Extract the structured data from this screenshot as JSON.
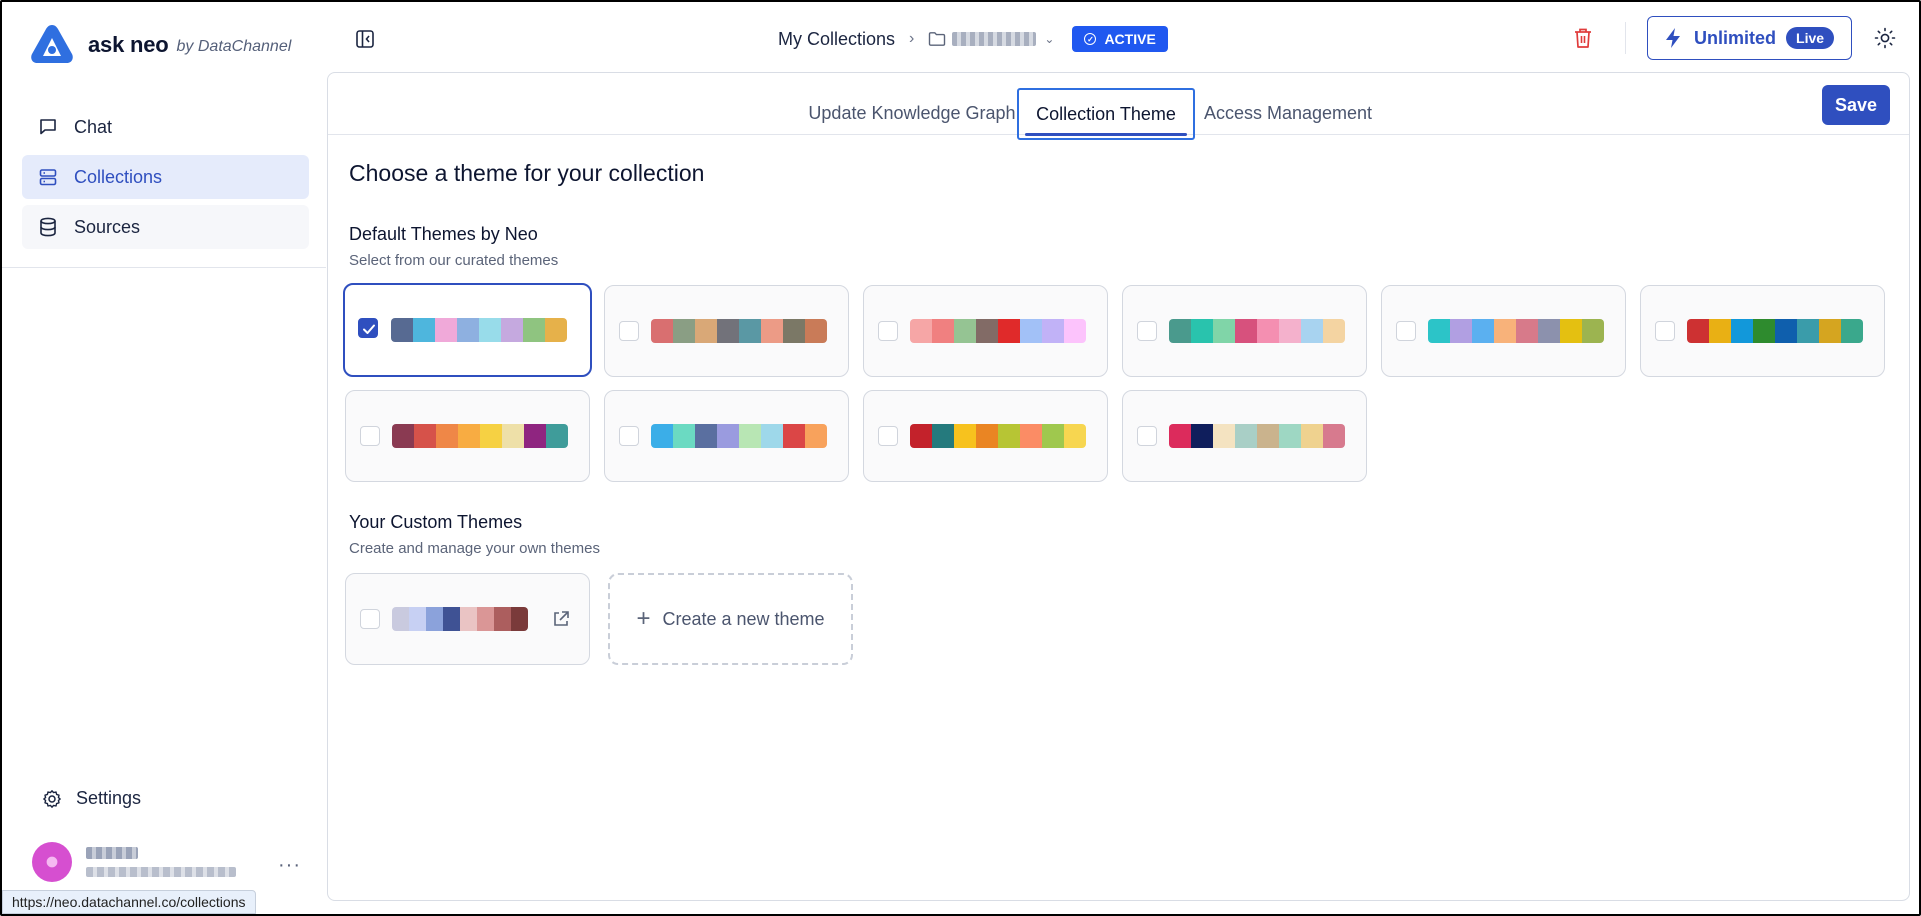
{
  "app": {
    "name": "ask neo",
    "by": "by DataChannel"
  },
  "sidebar": {
    "items": [
      {
        "label": "Chat",
        "icon": "chat-bubble-icon"
      },
      {
        "label": "Collections",
        "icon": "collections-icon",
        "active": true
      },
      {
        "label": "Sources",
        "icon": "database-icon"
      }
    ],
    "settings_label": "Settings",
    "more_label": "···"
  },
  "status_url": "https://neo.datachannel.co/collections",
  "header": {
    "breadcrumb_root": "My Collections",
    "separator": "›",
    "status": "ACTIVE",
    "plan_label": "Unlimited",
    "plan_badge": "Live"
  },
  "tabs": [
    {
      "label": "Update Knowledge Graph"
    },
    {
      "label": "Collection Theme",
      "selected": true
    },
    {
      "label": "Access Management"
    }
  ],
  "save_label": "Save",
  "theme_page": {
    "title": "Choose a theme for your collection",
    "default_heading": "Default Themes by Neo",
    "default_sub": "Select from our curated themes",
    "custom_heading": "Your Custom Themes",
    "custom_sub": "Create and manage your own themes",
    "create_label": "Create a new theme"
  },
  "default_themes": [
    {
      "selected": true,
      "colors": [
        "#576a92",
        "#4eb6dd",
        "#f0a9d9",
        "#8eb0e0",
        "#98dcea",
        "#c5a9df",
        "#8fc480",
        "#e6b14a"
      ]
    },
    {
      "selected": false,
      "colors": [
        "#d96f70",
        "#8a9e84",
        "#d9a877",
        "#72727a",
        "#5a98a4",
        "#ec9b86",
        "#7b7866",
        "#c97b58"
      ]
    },
    {
      "selected": false,
      "colors": [
        "#f6a6a6",
        "#f08080",
        "#95c493",
        "#826b66",
        "#e02a2a",
        "#a2c1f7",
        "#c1b2f7",
        "#fcc3fc"
      ]
    },
    {
      "selected": false,
      "colors": [
        "#4a9a8d",
        "#29c3ad",
        "#80d5a8",
        "#d7517d",
        "#f48fb1",
        "#f4b1cc",
        "#a8d3f0",
        "#f4d4a2"
      ]
    },
    {
      "selected": false,
      "colors": [
        "#2cc4c8",
        "#b19fe2",
        "#5bb0f0",
        "#f8b27a",
        "#d77a8a",
        "#8c91ad",
        "#e4c011",
        "#9cb450"
      ]
    },
    {
      "selected": false,
      "colors": [
        "#cd3132",
        "#e9b014",
        "#1298da",
        "#2e8b2e",
        "#0f5fad",
        "#3a9caa",
        "#d5a520",
        "#3aa88c"
      ]
    },
    {
      "selected": false,
      "colors": [
        "#8a3a52",
        "#d6524a",
        "#ef8747",
        "#f8ac42",
        "#f6d143",
        "#eee0a8",
        "#8f2580",
        "#3f9c9a"
      ]
    },
    {
      "selected": false,
      "colors": [
        "#3baee8",
        "#6bdac2",
        "#5a6fa0",
        "#9a9bdf",
        "#b8e6b4",
        "#9ed8ea",
        "#db4646",
        "#f8a25c"
      ]
    },
    {
      "selected": false,
      "colors": [
        "#c3222b",
        "#257a7d",
        "#f7c21e",
        "#ea8523",
        "#b7c534",
        "#fb8c65",
        "#9fc84e",
        "#f7d650"
      ]
    },
    {
      "selected": false,
      "colors": [
        "#dc2b5c",
        "#0f1e5c",
        "#f4e3c1",
        "#a9cfc6",
        "#cab38d",
        "#9ed7c3",
        "#efd28f",
        "#d77a8e"
      ]
    }
  ],
  "custom_themes": [
    {
      "selected": false,
      "colors": [
        "#c9cadf",
        "#c7d0f3",
        "#8ba2db",
        "#3f5294",
        "#eac4c4",
        "#da9696",
        "#ac5e5e",
        "#7a3a3a"
      ]
    }
  ]
}
